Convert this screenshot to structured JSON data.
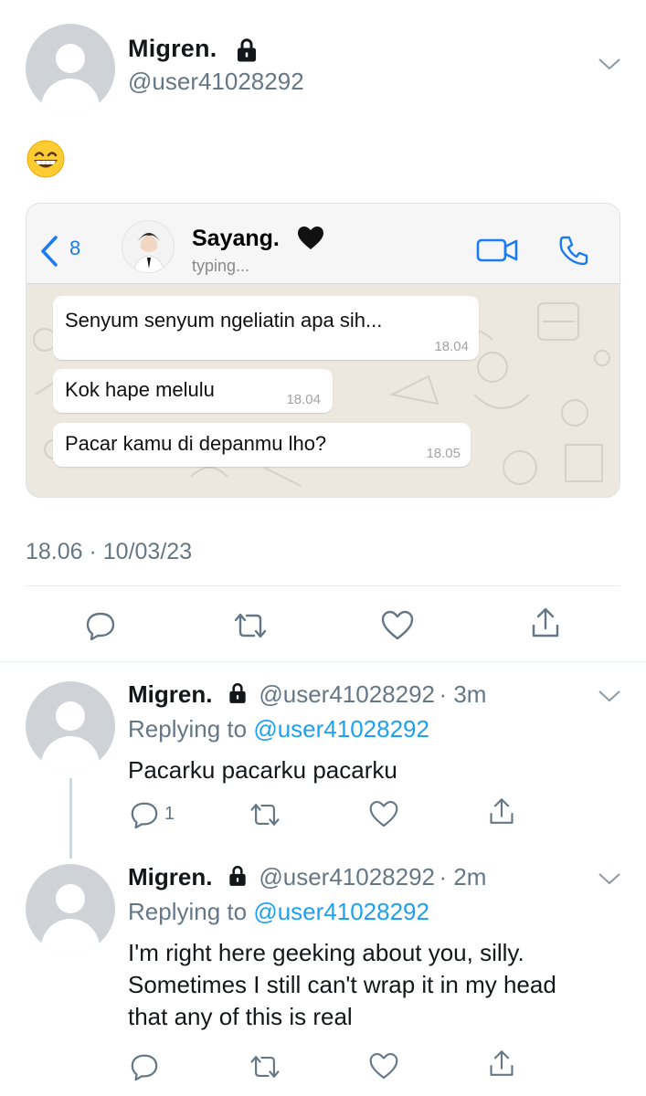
{
  "tweet": {
    "author_name": "Migren.",
    "author_handle": "@user41028292",
    "emoji_icon": "grinning-face-emoji",
    "timestamp": "18.06 · 10/03/23"
  },
  "chat": {
    "back_count": "8",
    "contact_name": "Sayang.",
    "contact_heart_icon": "black-heart",
    "status": "typing...",
    "messages": [
      {
        "text": "Senyum senyum ngeliatin apa sih...",
        "time": "18.04"
      },
      {
        "text": "Kok hape melulu",
        "time": "18.04"
      },
      {
        "text": "Pacar kamu di depanmu lho?",
        "time": "18.05"
      }
    ]
  },
  "replies": [
    {
      "name": "Migren.",
      "handle": "@user41028292",
      "age": "· 3m",
      "replying_label": "Replying to ",
      "replying_to": "@user41028292",
      "text_lines": [
        "Pacarku pacarku pacarku"
      ],
      "reply_count": "1"
    },
    {
      "name": "Migren.",
      "handle": "@user41028292",
      "age": "· 2m",
      "replying_label": "Replying to ",
      "replying_to": "@user41028292",
      "text_lines": [
        "I'm right here geeking about you, silly.",
        "Sometimes I still can't wrap it in my head",
        "that any of this is real"
      ],
      "reply_count": ""
    }
  ],
  "colors": {
    "link": "#1da1f2",
    "muted": "#657786",
    "chat_accent": "#1a7cf0",
    "chat_wallpaper": "#ece7df"
  }
}
